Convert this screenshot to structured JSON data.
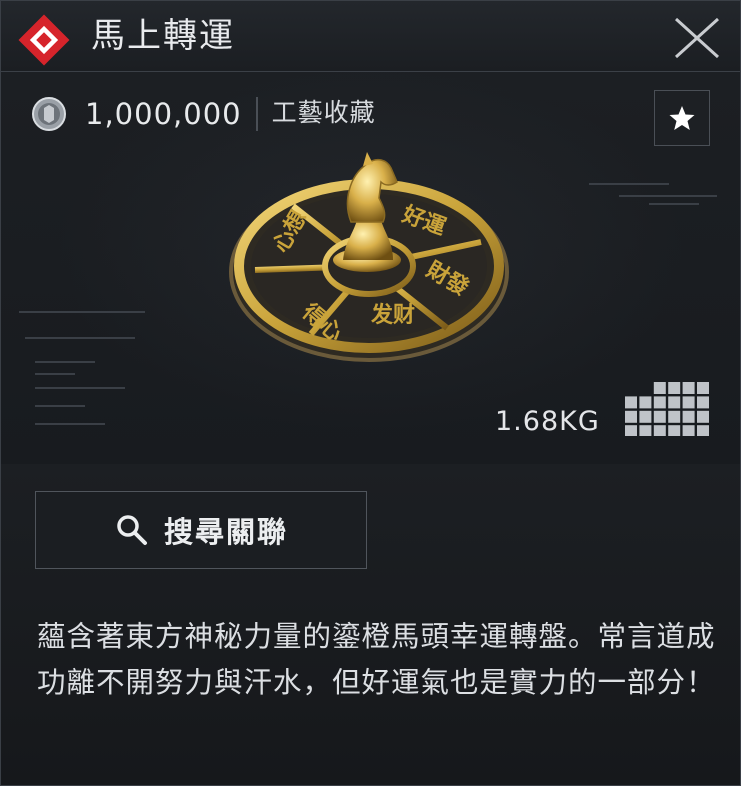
{
  "window": {
    "title": "馬上轉運",
    "close_icon": "close-icon"
  },
  "item": {
    "price": "1,000,000",
    "category": "工藝收藏",
    "currency_icon": "coin-icon",
    "favorite_icon": "star-icon",
    "weight": "1.68KG",
    "art_labels": [
      "好運",
      "財發",
      "發財",
      "福到",
      "心想"
    ],
    "size_grid": {
      "columns": 6,
      "rows": 4,
      "empty_cells": [
        [
          0,
          0
        ],
        [
          1,
          0
        ]
      ]
    }
  },
  "actions": {
    "search_label": "搜尋關聯",
    "search_icon": "magnifier-icon"
  },
  "description": "蘊含著東方神秘力量的鎏橙馬頭幸運轉盤。常言道成功離不開努力與汗水，但好運氣也是實力的一部分！",
  "colors": {
    "accent_red": "#d6242b",
    "gold": "#c9a33a",
    "panel_bg": "#15181c",
    "text": "#dcdfe3"
  }
}
